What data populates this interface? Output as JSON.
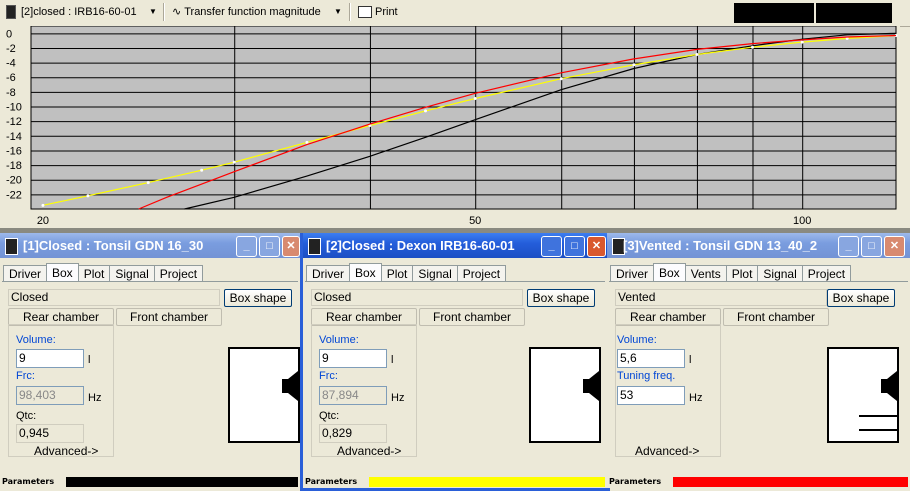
{
  "toolbar": {
    "selected_box": "[2]closed : IRB16-60-01",
    "graph_type": "Transfer function magnitude",
    "print_label": "Print"
  },
  "chart_data": {
    "type": "line",
    "xscale": "log",
    "xlim": [
      19.5,
      122
    ],
    "ylim": [
      -24,
      1
    ],
    "y_ticks": [
      0,
      -2,
      -4,
      -6,
      -8,
      -10,
      -12,
      -14,
      -16,
      -18,
      -20,
      -22
    ],
    "x_tick_labels": [
      "20",
      "50",
      "100"
    ],
    "x_ticks": [
      20,
      50,
      100
    ],
    "grid": true,
    "background": "#c0c0c0",
    "series": [
      {
        "color": "#000000",
        "x": [
          27,
          30,
          35,
          40,
          45,
          50,
          60,
          70,
          80,
          90,
          100,
          110,
          122
        ],
        "y": [
          -24,
          -22.4,
          -19.5,
          -16.8,
          -14.2,
          -11.8,
          -7.7,
          -4.8,
          -2.9,
          -1.7,
          -0.8,
          -0.2,
          0
        ]
      },
      {
        "color": "#ffff00",
        "x": [
          20,
          22,
          25,
          28,
          30,
          35,
          40,
          45,
          50,
          60,
          70,
          80,
          90,
          100,
          110,
          122
        ],
        "y": [
          -23.5,
          -22.2,
          -20.4,
          -18.7,
          -17.6,
          -14.9,
          -12.6,
          -10.6,
          -8.9,
          -6.2,
          -4.3,
          -2.9,
          -1.9,
          -1.2,
          -0.7,
          -0.3
        ]
      },
      {
        "color": "#ff0000",
        "x": [
          24.5,
          26,
          28,
          30,
          35,
          40,
          45,
          50,
          60,
          70,
          80,
          90,
          100,
          110,
          122
        ],
        "y": [
          -24,
          -22.4,
          -20.6,
          -18.9,
          -15.2,
          -12.4,
          -10.1,
          -8.2,
          -5.4,
          -3.5,
          -2.2,
          -1.4,
          -0.9,
          -0.5,
          -0.3
        ]
      }
    ]
  },
  "windows": [
    {
      "title": "[1]Closed : Tonsil GDN 16_30",
      "tabs": [
        "Driver",
        "Box",
        "Plot",
        "Signal",
        "Project"
      ],
      "box_type": "Closed",
      "box_shape_label": "Box shape",
      "rear_chamber": "Rear chamber",
      "front_chamber": "Front chamber",
      "volume_label": "Volume:",
      "volume": "9",
      "volume_unit": "l",
      "freq_label": "Frc:",
      "freq": "98,403",
      "freq_unit": "Hz",
      "q_label": "Qtc:",
      "q": "0,945",
      "advanced": "Advanced->",
      "status_label": "Parameters",
      "color": "#000000"
    },
    {
      "title": "[2]Closed : Dexon IRB16-60-01",
      "tabs": [
        "Driver",
        "Box",
        "Plot",
        "Signal",
        "Project"
      ],
      "box_type": "Closed",
      "box_shape_label": "Box shape",
      "rear_chamber": "Rear chamber",
      "front_chamber": "Front chamber",
      "volume_label": "Volume:",
      "volume": "9",
      "volume_unit": "l",
      "freq_label": "Frc:",
      "freq": "87,894",
      "freq_unit": "Hz",
      "q_label": "Qtc:",
      "q": "0,829",
      "advanced": "Advanced->",
      "status_label": "Parameters",
      "color": "#ffff00"
    },
    {
      "title": "[3]Vented : Tonsil GDN 13_40_2",
      "tabs": [
        "Driver",
        "Box",
        "Vents",
        "Plot",
        "Signal",
        "Project"
      ],
      "box_type": "Vented",
      "box_shape_label": "Box shape",
      "rear_chamber": "Rear chamber",
      "front_chamber": "Front chamber",
      "volume_label": "Volume:",
      "volume": "5,6",
      "volume_unit": "l",
      "freq_label": "Tuning freq.",
      "freq": "53",
      "freq_unit": "Hz",
      "advanced": "Advanced->",
      "status_label": "Parameters",
      "color": "#ff0000"
    }
  ]
}
